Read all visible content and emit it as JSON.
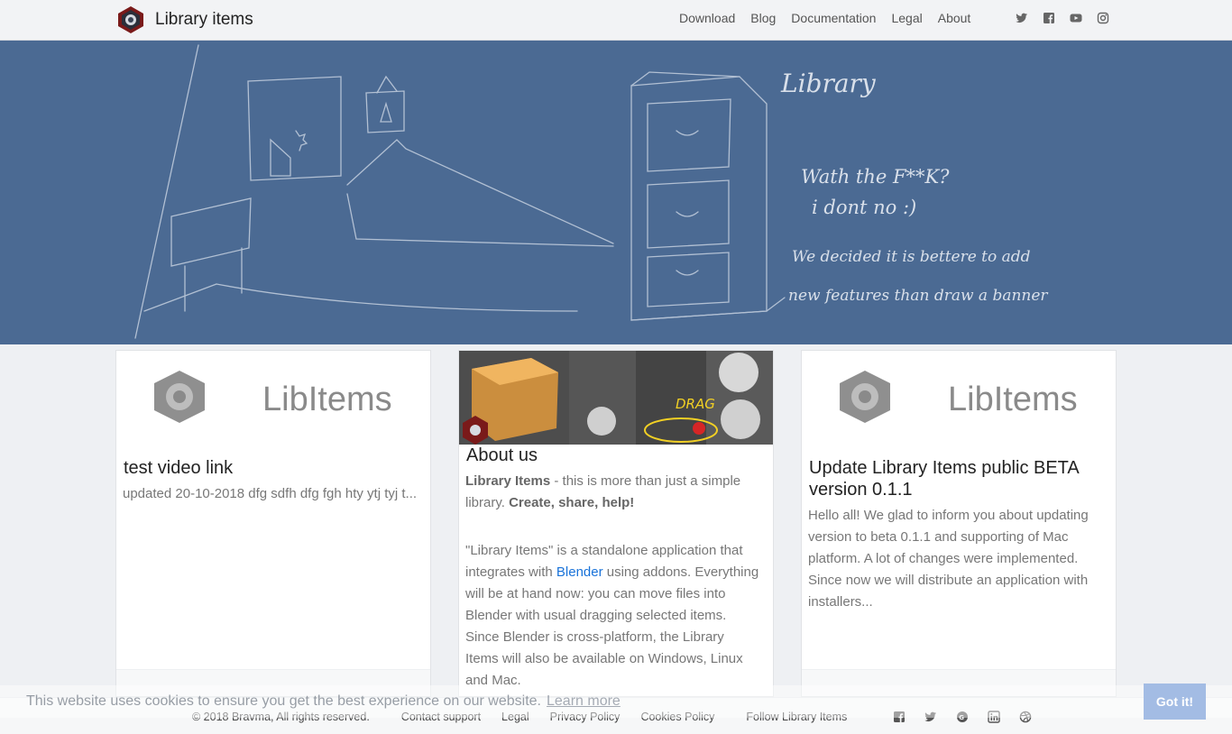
{
  "header": {
    "brand": "Library items",
    "nav": [
      "Download",
      "Blog",
      "Documentation",
      "Legal",
      "About"
    ],
    "social_icons": [
      "twitter-icon",
      "facebook-icon",
      "youtube-icon",
      "instagram-icon"
    ]
  },
  "banner": {
    "line1": "Library",
    "line2": "Wath the F**K?",
    "line3": "i dont no :)",
    "line4": "We decided it is bettere to add",
    "line5": "new features than draw a banner"
  },
  "cards": [
    {
      "logo_text": "LibItems",
      "title": "test video link",
      "text": "updated 20-10-2018 dfg sdfh dfg fgh hty ytj tyj t..."
    },
    {
      "image_label": "DRAG",
      "title": "About us",
      "lead_bold": "Library Items",
      "lead_mid": " - this is more than just a simple library. ",
      "lead_bold2": "Create, share, help!",
      "p2_before": "\"Library Items\" is a standalone application that integrates with ",
      "p2_link": "Blender",
      "p2_after": " using addons. Everything will be at hand now: you can move files into Blender with usual dragging selected items. Since Blender is cross-platform, the Library Items will also be available on Windows, Linux and Mac."
    },
    {
      "logo_text": "LibItems",
      "title": "Update Library Items public BETA version 0.1.1",
      "text": "Hello all! We glad to inform you about updating version to beta 0.1.1 and supporting of Mac platform. A lot of changes were implemented. Since now we will distribute an application with installers..."
    }
  ],
  "footer": {
    "copyright": "© 2018 Bravma, All rights reserved.",
    "links": [
      "Contact support",
      "Legal",
      "Privacy Policy",
      "Cookies Policy"
    ],
    "follow": "Follow Library Items",
    "social_icons": [
      "facebook-icon",
      "twitter-icon",
      "google-plus-icon",
      "linkedin-icon",
      "dribbble-icon"
    ]
  },
  "cookie": {
    "message": "This website uses cookies to ensure you get the best experience on our website.",
    "learn_more": "Learn more",
    "button": "Got it!"
  },
  "colors": {
    "banner": "#4b6a93",
    "link": "#1a73d9",
    "cookie_button": "#a3bce4"
  }
}
